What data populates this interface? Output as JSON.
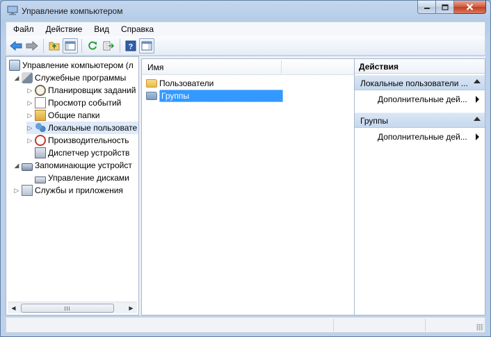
{
  "window": {
    "title": "Управление компьютером"
  },
  "menubar": {
    "items": [
      {
        "label": "Файл"
      },
      {
        "label": "Действие"
      },
      {
        "label": "Вид"
      },
      {
        "label": "Справка"
      }
    ]
  },
  "toolbar": {
    "icons": [
      "back-arrow-icon",
      "forward-arrow-icon",
      "up-folder-icon",
      "show-hide-tree-icon",
      "refresh-icon",
      "export-list-icon",
      "help-icon",
      "action-pane-icon"
    ]
  },
  "tree": {
    "root": {
      "label": "Управление компьютером (л"
    },
    "system_tools": {
      "label": "Служебные программы"
    },
    "task_scheduler": {
      "label": "Планировщик заданий"
    },
    "event_viewer": {
      "label": "Просмотр событий"
    },
    "shared_folders": {
      "label": "Общие папки"
    },
    "local_users": {
      "label": "Локальные пользовате"
    },
    "performance": {
      "label": "Производительность"
    },
    "device_manager": {
      "label": "Диспетчер устройств"
    },
    "storage": {
      "label": "Запоминающие устройст"
    },
    "disk_management": {
      "label": "Управление дисками"
    },
    "services_apps": {
      "label": "Службы и приложения"
    }
  },
  "list": {
    "column_name": "Имя",
    "items": [
      {
        "label": "Пользователи",
        "selected": false
      },
      {
        "label": "Группы",
        "selected": true
      }
    ]
  },
  "actions": {
    "header": "Действия",
    "sections": [
      {
        "title": "Локальные пользователи ...",
        "item": "Дополнительные дей..."
      },
      {
        "title": "Группы",
        "item": "Дополнительные дей..."
      }
    ]
  },
  "colors": {
    "selection": "#3399ff",
    "section_bg": "#c6d8ee",
    "close_button": "#c33d1f"
  }
}
